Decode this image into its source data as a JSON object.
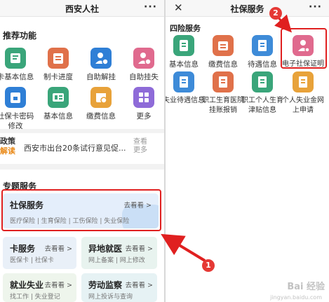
{
  "left": {
    "header": {
      "title": "西安人社",
      "more": "···"
    },
    "recommend_title": "推荐功能",
    "tiles": [
      {
        "label": "卡基本信息",
        "color": "#3aa57a",
        "icon": "card-icon"
      },
      {
        "label": "制卡进度",
        "color": "#e0714a",
        "icon": "progress-icon"
      },
      {
        "label": "自助解挂",
        "color": "#2f7fd6",
        "icon": "person-icon"
      },
      {
        "label": "自助挂失",
        "color": "#e06a8e",
        "icon": "person-lock-icon"
      },
      {
        "label": "社保卡密码修改",
        "color": "#2f7fd6",
        "icon": "lock-card-icon"
      },
      {
        "label": "基本信息",
        "color": "#3aa57a",
        "icon": "id-icon"
      },
      {
        "label": "缴费信息",
        "color": "#e8a23a",
        "icon": "calendar-icon"
      },
      {
        "label": "更多",
        "color": "#8e6bd8",
        "icon": "grid-icon"
      }
    ],
    "news": {
      "badge_top": "政策",
      "badge_bottom": "解读",
      "text": "西安市出台20条试行意见促...",
      "more_top": "查看",
      "more_bottom": "更多"
    },
    "special_title": "专题服务",
    "cards": [
      {
        "title": "社保服务",
        "more": "去看看 >",
        "sub": "医疗保险 | 生育保险 | 工伤保险 | 失业保险",
        "bg": "#e4eefb"
      },
      {
        "title": "卡服务",
        "more": "去看看 >",
        "sub": "医保卡 | 社保卡",
        "bg": "#e9f0f8"
      },
      {
        "title": "异地就医",
        "more": "去看看 >",
        "sub": "网上备案 | 网上修改",
        "bg": "#e8f3ef"
      },
      {
        "title": "就业失业",
        "more": "去看看 >",
        "sub": "找工作 | 失业登记",
        "bg": "#eef5ec"
      },
      {
        "title": "劳动监察",
        "more": "去看看 >",
        "sub": "网上投诉与查询",
        "bg": "#e6f2f4"
      }
    ],
    "step": "1"
  },
  "right": {
    "header": {
      "title": "社保服务",
      "close": "✕",
      "more": "···"
    },
    "section_title": "四险服务",
    "tiles": [
      {
        "label": "基本信息",
        "color": "#3aa57a",
        "icon": "id-icon"
      },
      {
        "label": "缴费信息",
        "color": "#e0714a",
        "icon": "wallet-icon"
      },
      {
        "label": "待遇信息",
        "color": "#3e8bd8",
        "icon": "document-icon"
      },
      {
        "label": "电子社保证明",
        "color": "#e06a8e",
        "icon": "person-cert-icon"
      },
      {
        "label": "失业待遇信息",
        "color": "#3e8bd8",
        "icon": "document-icon"
      },
      {
        "label": "职工生育医院挂账报销",
        "color": "#e0714a",
        "icon": "document-icon"
      },
      {
        "label": "职工个人生育津贴信息",
        "color": "#3aa57a",
        "icon": "document-icon"
      },
      {
        "label": "个人失业金网上申请",
        "color": "#e8a23a",
        "icon": "document-icon"
      }
    ],
    "step": "2"
  },
  "watermark": {
    "brand": "Bai 经验",
    "url": "jingyan.baidu.com"
  },
  "colors": {
    "accent_red": "#e02020",
    "step_red": "#e53935"
  }
}
